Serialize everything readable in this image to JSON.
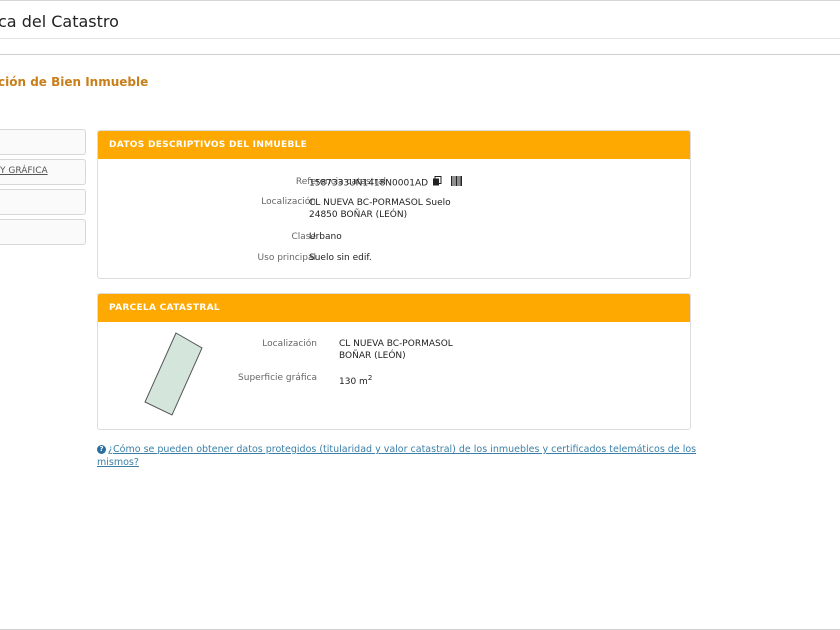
{
  "header": {
    "site_title": "ca del Catastro"
  },
  "page": {
    "subtitle": "ción de Bien Inmueble"
  },
  "sidebar": {
    "items": [
      {
        "label": ""
      },
      {
        "label": "Y GRÁFICA"
      },
      {
        "label": ""
      },
      {
        "label": ""
      }
    ]
  },
  "datos": {
    "title": "DATOS DESCRIPTIVOS DEL INMUEBLE",
    "ref_label": "Referencia catastral",
    "ref_value": "1587333UN1418N0001AD",
    "loc_label": "Localización",
    "loc_line1": "CL NUEVA BC-PORMASOL Suelo",
    "loc_line2": "24850 BOÑAR (LEÓN)",
    "clase_label": "Clase",
    "clase_value": "Urbano",
    "uso_label": "Uso principal",
    "uso_value": "Suelo sin edif."
  },
  "parcela": {
    "title": "PARCELA CATASTRAL",
    "loc_label": "Localización",
    "loc_line1": "CL NUEVA BC-PORMASOL",
    "loc_line2": "BOÑAR (LEÓN)",
    "sup_label": "Superficie gráfica",
    "sup_value": "130 m",
    "sup_unit_exp": "2"
  },
  "info": {
    "link_text": "¿Cómo se pueden obtener datos protegidos (titularidad y valor catastral) de los inmuebles y certificados telemáticos de los mismos?"
  },
  "icons": {
    "copy": "copy-icon",
    "barcode": "barcode-icon",
    "help": "help-icon"
  },
  "colors": {
    "panel_header": "#fea802",
    "subtitle": "#c87f1a",
    "link": "#3a7fa8",
    "parcel_fill": "#d4e5dc"
  }
}
